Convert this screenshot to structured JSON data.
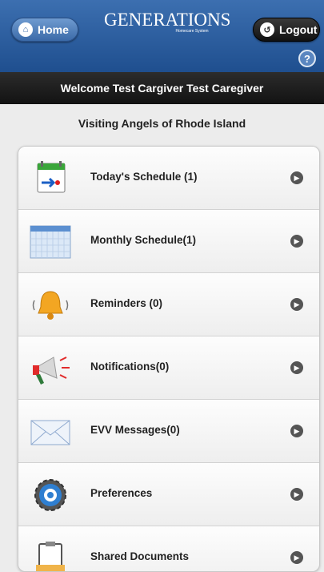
{
  "header": {
    "home_label": "Home",
    "logout_label": "Logout",
    "brand_name": "GENERATIONS",
    "brand_tagline": "Homecare System",
    "help_label": "?"
  },
  "welcome_text": "Welcome Test Cargiver Test Caregiver",
  "agency_name": "Visiting Angels of Rhode Island",
  "menu": {
    "items": [
      {
        "label": "Today's Schedule (1)",
        "icon": "todays-schedule-icon"
      },
      {
        "label": "Monthly Schedule(1)",
        "icon": "monthly-schedule-icon"
      },
      {
        "label": "Reminders (0)",
        "icon": "bell-icon"
      },
      {
        "label": "Notifications(0)",
        "icon": "megaphone-icon"
      },
      {
        "label": "EVV Messages(0)",
        "icon": "envelope-icon"
      },
      {
        "label": "Preferences",
        "icon": "gear-icon"
      },
      {
        "label": "Shared Documents",
        "icon": "clipboard-icon"
      }
    ]
  },
  "colors": {
    "header_blue": "#1f4f8f",
    "welcome_bar": "#121212",
    "background": "#ececec"
  }
}
